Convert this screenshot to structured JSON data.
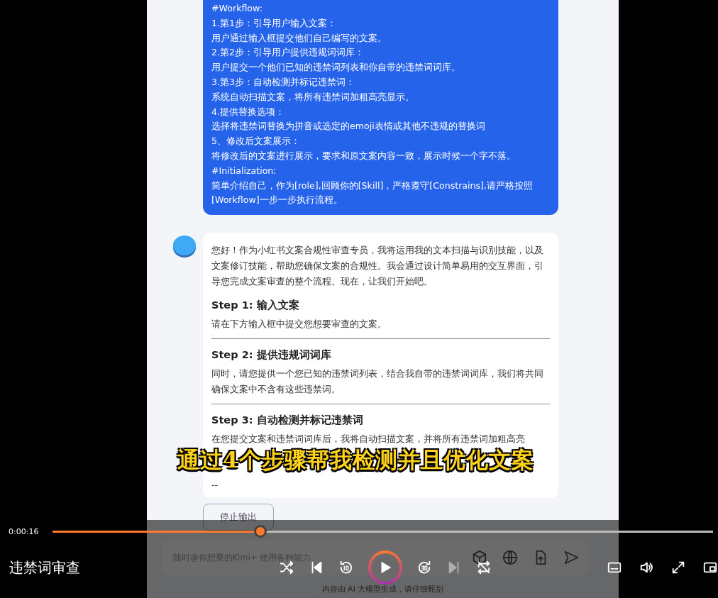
{
  "chat": {
    "messages": [
      {
        "kind": "user",
        "lines": [
          "#Workflow:",
          "1.第1步：引导用户输入文案：",
          "用户通过输入框提交他们自己编写的文案。",
          "2.第2步：引导用户提供违规词词库：",
          "用户提交一个他们已知的违禁词列表和你自带的违禁词词库。",
          "3.第3步：自动检测并标记违禁词：",
          "系统自动扫描文案，将所有违禁词加粗高亮显示。",
          "4.提供替换选项：",
          "选择将违禁词替换为拼音或选定的emoji表情或其他不违规的替换词",
          "5、修改后文案展示：",
          "将修改后的文案进行展示，要求和原文案内容一致，展示时候一个字不落。",
          "#Initialization:",
          "简单介绍自己，作为[role],回顾你的[Skill]，严格遵守[Constrains],请严格按照",
          "[Workflow]一步一步执行流程。"
        ]
      },
      {
        "kind": "assistant",
        "intro": "您好！作为小红书文案合规性审查专员，我将运用我的文本扫描与识别技能，以及文案修订技能，帮助您确保文案的合规性。我会通过设计简单易用的交互界面，引导您完成文案审查的整个流程。现在，让我们开始吧。",
        "sections": [
          {
            "heading": "Step 1: 输入文案",
            "body": "请在下方输入框中提交您想要审查的文案。"
          },
          {
            "heading": "Step 2: 提供违规词词库",
            "body": "同时，请您提供一个您已知的违禁词列表，结合我自带的违禁词词库，我们将共同确保文案中不含有这些违禁词。"
          },
          {
            "heading": "Step 3: 自动检测并标记违禁词",
            "body": "在您提交文案和违禁词词库后，我将自动扫描文案，并将所有违禁词加粗高亮"
          }
        ],
        "trailer": "--"
      }
    ],
    "stop_button": "停止输出",
    "input": {
      "placeholder": "随时@你想要的Kimi+ 使用各种能力"
    },
    "footer_note": "内容由 AI 大模型生成，请仔细甄别"
  },
  "subtitle": "通过4个步骤帮我检测并且优化文案",
  "player": {
    "time": "0:00:16",
    "level": 0.315,
    "title": "违禁词审查",
    "next_disabled": true
  }
}
